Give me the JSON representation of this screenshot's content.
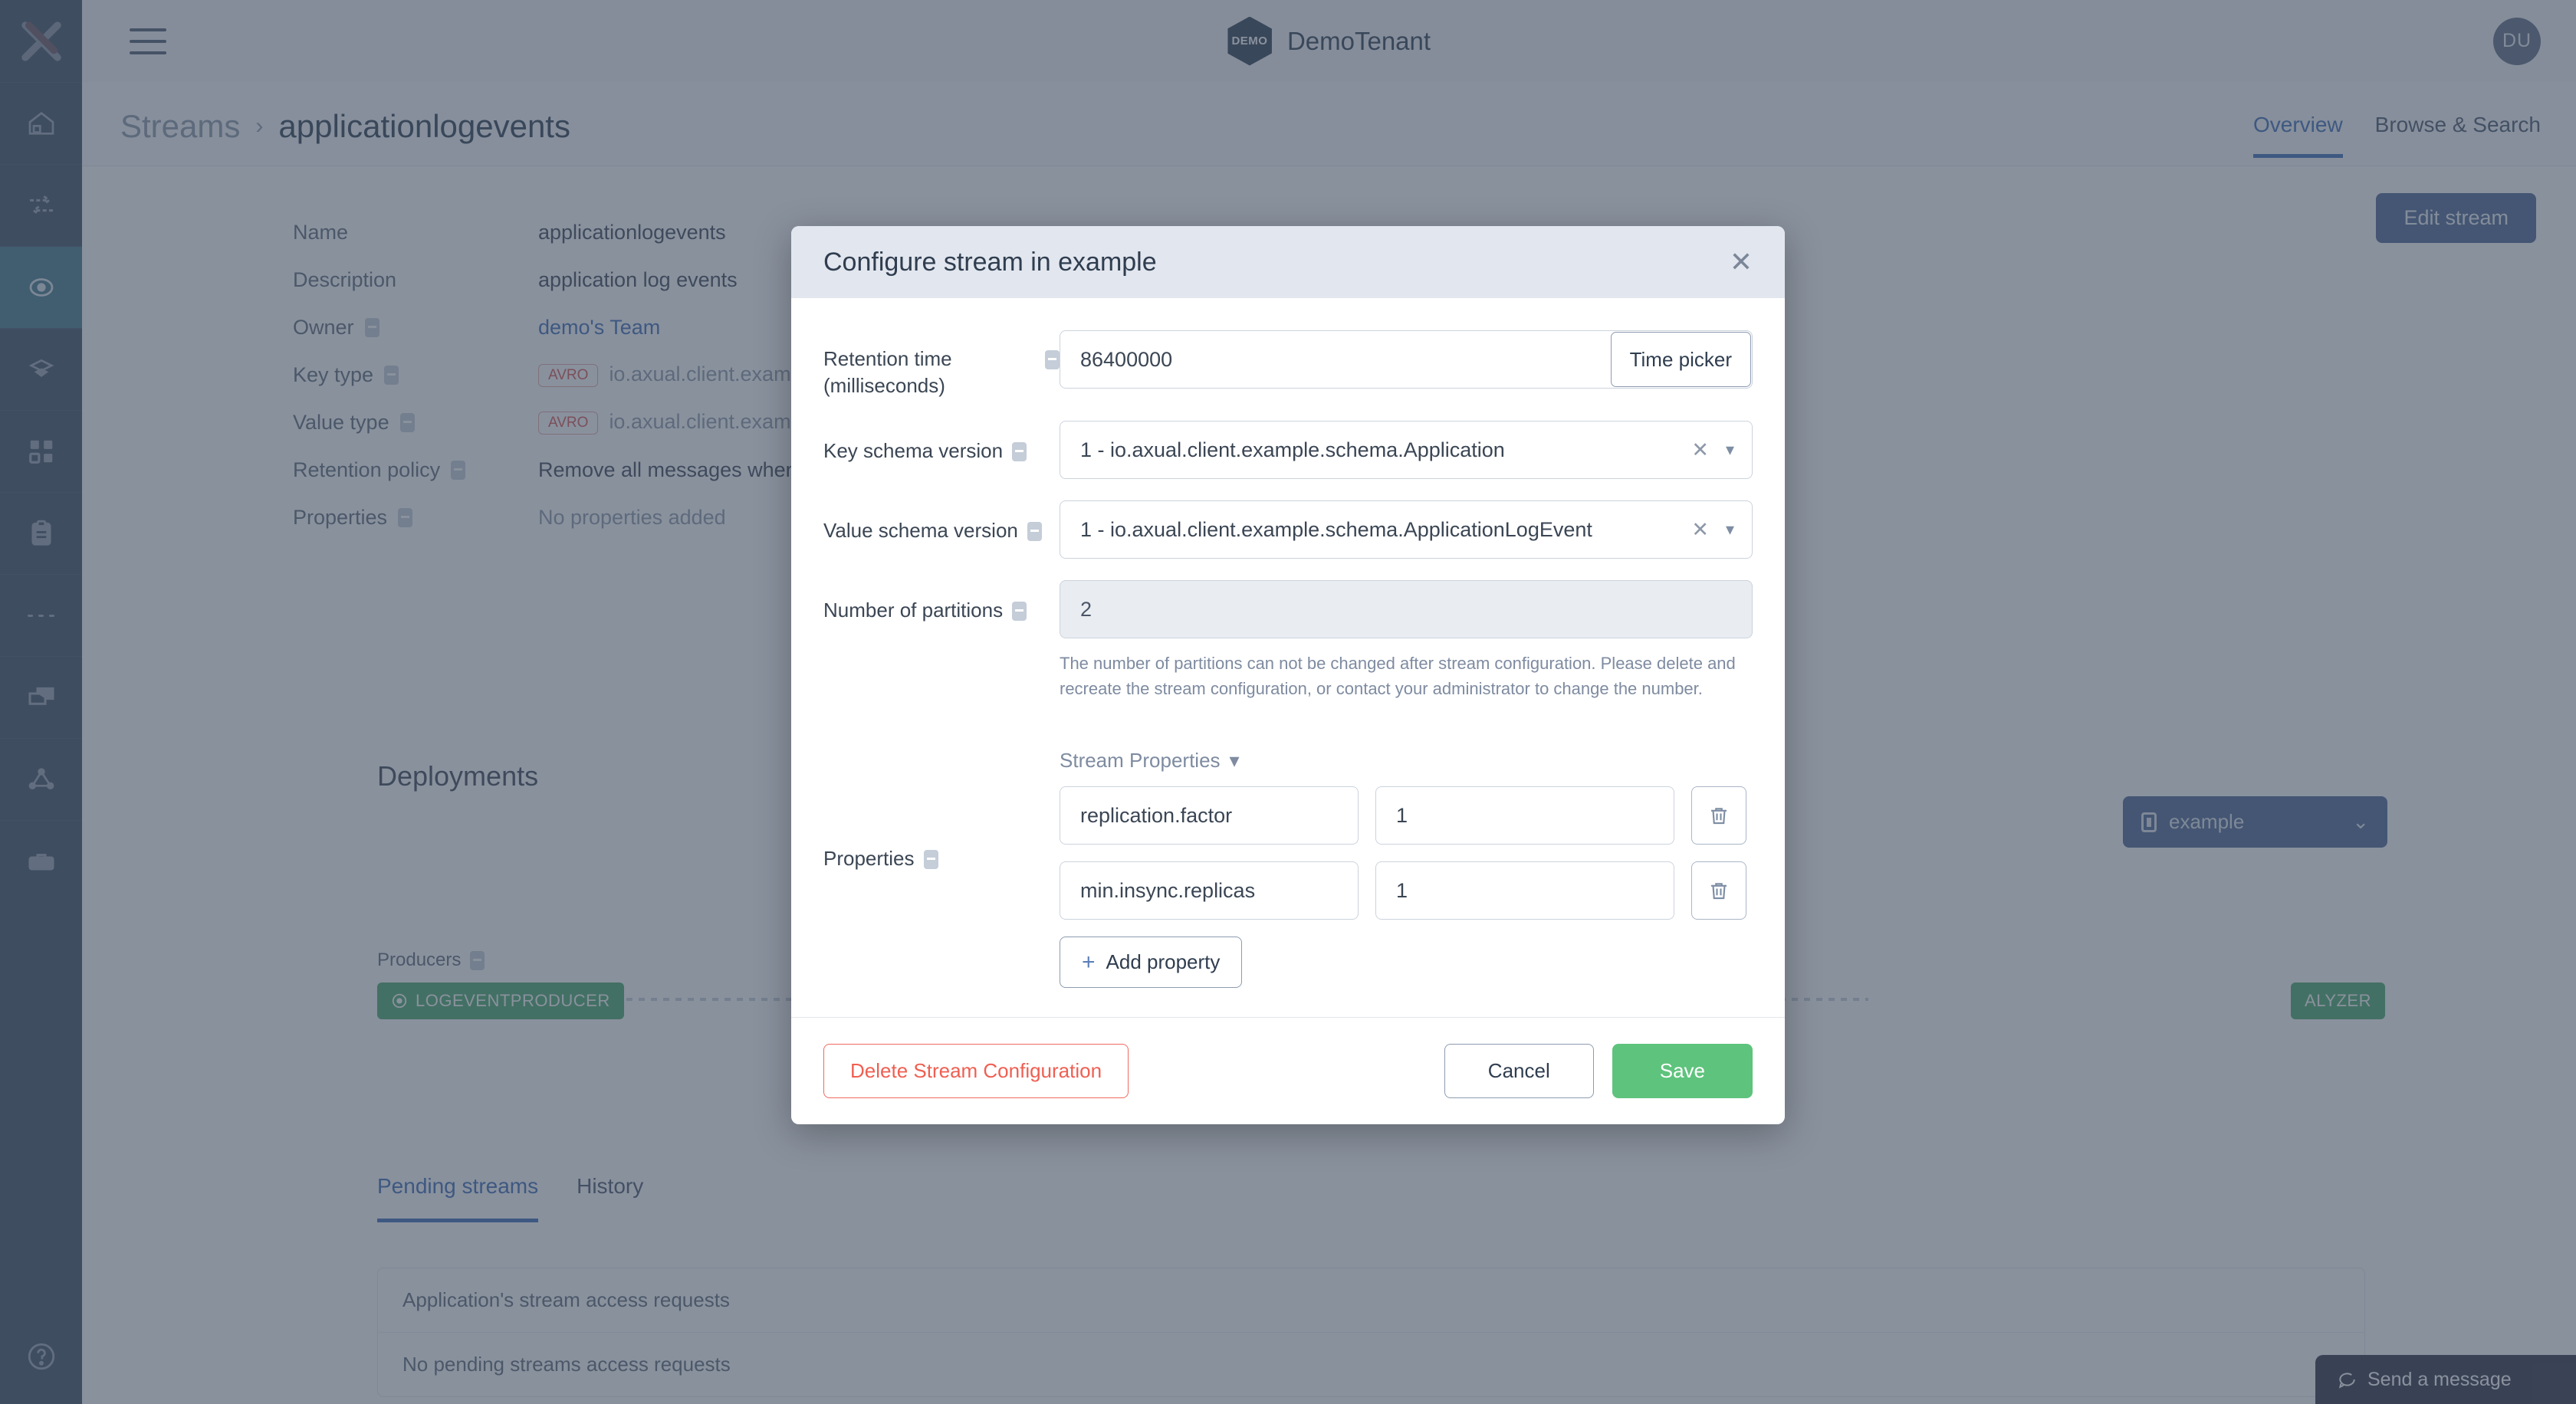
{
  "sidebar": {
    "logo_icon": "x-logo-icon",
    "items": [
      {
        "name": "home",
        "icon": "home-icon",
        "active": false
      },
      {
        "name": "connect",
        "icon": "exchange-arrows-icon",
        "active": false
      },
      {
        "name": "streams",
        "icon": "target-eye-icon",
        "active": true
      },
      {
        "name": "schemas",
        "icon": "layers-hexagon-icon",
        "active": false
      },
      {
        "name": "applications",
        "icon": "grid-squares-icon",
        "active": false
      },
      {
        "name": "clipboard",
        "icon": "clipboard-icon",
        "active": false
      },
      {
        "name": "more",
        "icon": "ellipsis-icon",
        "active": false
      },
      {
        "name": "environments",
        "icon": "windows-icon",
        "active": false
      },
      {
        "name": "topology",
        "icon": "graph-nodes-icon",
        "active": false
      },
      {
        "name": "toolbox",
        "icon": "toolbox-icon",
        "active": false
      }
    ],
    "help_icon": "question-circle-icon"
  },
  "topbar": {
    "menu_icon": "hamburger-icon",
    "tenant_badge": "DEMO",
    "tenant_name": "DemoTenant",
    "avatar_initials": "DU"
  },
  "breadcrumb": {
    "parent": "Streams",
    "separator": "›",
    "current": "applicationlogevents"
  },
  "header_tabs": [
    {
      "label": "Overview",
      "active": true
    },
    {
      "label": "Browse & Search",
      "active": false
    }
  ],
  "edit_stream_label": "Edit stream",
  "details": [
    {
      "label": "Name",
      "info": false,
      "value": "applicationlogevents",
      "style": "plain"
    },
    {
      "label": "Description",
      "info": false,
      "value": "application log events",
      "style": "plain"
    },
    {
      "label": "Owner",
      "info": true,
      "value": "demo's Team",
      "style": "link"
    },
    {
      "label": "Key type",
      "info": true,
      "value": "io.axual.client.exampl",
      "badge": "AVRO",
      "style": "muted"
    },
    {
      "label": "Value type",
      "info": true,
      "value": "io.axual.client.exampl",
      "badge": "AVRO",
      "style": "muted"
    },
    {
      "label": "Retention policy",
      "info": true,
      "value": "Remove all messages when th",
      "style": "plain"
    },
    {
      "label": "Properties",
      "info": true,
      "value": "No properties added",
      "style": "muted"
    }
  ],
  "deployments": {
    "title": "Deployments",
    "producers_label": "Producers",
    "producer_badge": "LOGEVENTPRODUCER",
    "consumer_badge": "ALYZER",
    "environment": "example",
    "env_icon": "environment-icon",
    "env_chevron": "⌄"
  },
  "lower_tabs": [
    {
      "label": "Pending streams",
      "active": true
    },
    {
      "label": "History",
      "active": false
    }
  ],
  "requests_panel": {
    "header": "Application's stream access requests",
    "empty": "No pending streams access requests"
  },
  "chat": {
    "icon": "speech-bubble-icon",
    "label": "Send a message"
  },
  "modal": {
    "title": "Configure stream in example",
    "close_icon": "close-icon",
    "retention": {
      "label": "Retention time (milliseconds)",
      "value": "86400000",
      "time_picker_label": "Time picker"
    },
    "key_schema": {
      "label": "Key schema version",
      "value": "1 - io.axual.client.example.schema.Application",
      "clear_icon": "clear-x-icon",
      "chevron_icon": "chevron-down-icon"
    },
    "value_schema": {
      "label": "Value schema version",
      "value": "1 - io.axual.client.example.schema.ApplicationLogEvent",
      "clear_icon": "clear-x-icon",
      "chevron_icon": "chevron-down-icon"
    },
    "partitions": {
      "label": "Number of partitions",
      "value": "2",
      "help": "The number of partitions can not be changed after stream configuration. Please delete and recreate the stream configuration, or contact your administrator to change the number."
    },
    "stream_properties_toggle": "Stream Properties",
    "stream_properties_chevron": "⌄",
    "properties_label": "Properties",
    "properties": [
      {
        "key": "replication.factor",
        "value": "1",
        "delete_icon": "trash-icon"
      },
      {
        "key": "min.insync.replicas",
        "value": "1",
        "delete_icon": "trash-icon"
      }
    ],
    "add_property_label": "Add property",
    "add_property_plus": "+",
    "footer": {
      "delete_label": "Delete Stream Configuration",
      "cancel_label": "Cancel",
      "save_label": "Save"
    }
  },
  "colors": {
    "sidebar": "#3e4d61",
    "sidebar_active": "#43768a",
    "accent_blue": "#3b6bb5",
    "save_green": "#5ec37c",
    "danger_red": "#ef5f52",
    "badge_green": "#47a86a"
  }
}
